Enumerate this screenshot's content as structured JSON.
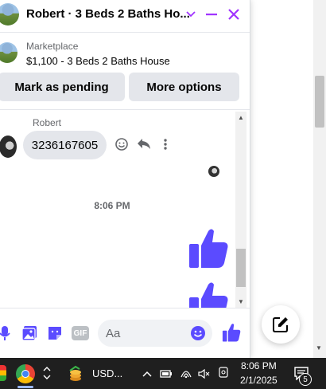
{
  "header": {
    "title": "Robert · 3 Beds 2 Baths Ho...",
    "icons": [
      "chevron-down-icon",
      "minimize-icon",
      "close-icon"
    ],
    "accent_color": "#a033ff"
  },
  "listing": {
    "label": "Marketplace",
    "title": "$1,100 - 3 Beds 2 Baths House"
  },
  "actions": {
    "pending_label": "Mark as pending",
    "more_label": "More options"
  },
  "messages": {
    "sender": "Robert",
    "received_text": "3236167605",
    "timestamp": "8:06 PM",
    "thumb_color": "#5b4bff"
  },
  "composer": {
    "placeholder": "Aa",
    "gif_label": "GIF"
  },
  "taskbar": {
    "app_label": "USD...",
    "time": "8:06 PM",
    "date": "2/1/2025",
    "notification_count": "5"
  }
}
